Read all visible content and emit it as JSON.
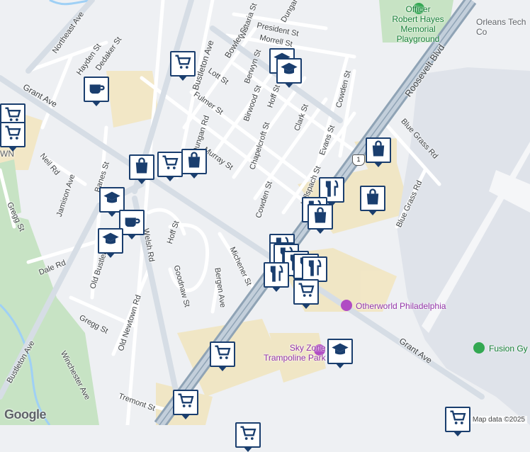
{
  "streets": [
    {
      "name": "Northeast Ave"
    },
    {
      "name": "Hayden St"
    },
    {
      "name": "Dedaker St"
    },
    {
      "name": "Bustleton Ave"
    },
    {
      "name": "Bowler St"
    },
    {
      "name": "Wistaria St"
    },
    {
      "name": "President St"
    },
    {
      "name": "Morrell St"
    },
    {
      "name": "Dungan"
    },
    {
      "name": "Lott St"
    },
    {
      "name": "Berwyn St"
    },
    {
      "name": "Grant Ave"
    },
    {
      "name": "Fulmer St"
    },
    {
      "name": "Birwood St"
    },
    {
      "name": "Hoff St"
    },
    {
      "name": "Cowden St"
    },
    {
      "name": "Chapelcroft St"
    },
    {
      "name": "Clark St"
    },
    {
      "name": "Evans St"
    },
    {
      "name": "Dungan Rd"
    },
    {
      "name": "Murray St"
    },
    {
      "name": "Roosevelt Blvd"
    },
    {
      "name": "Blue Grass Rd"
    },
    {
      "name": "Neil Rd"
    },
    {
      "name": "Banes St"
    },
    {
      "name": "Jamison Ave"
    },
    {
      "name": "Gregg St"
    },
    {
      "name": "Hillspach St"
    },
    {
      "name": "Welsh Rd"
    },
    {
      "name": "Hoff St"
    },
    {
      "name": "Dale Rd"
    },
    {
      "name": "Old Bustleton"
    },
    {
      "name": "Goodnaw St"
    },
    {
      "name": "Michener St"
    },
    {
      "name": "Bergen Ave"
    },
    {
      "name": "Old Newtown Rd"
    },
    {
      "name": "Winchester Ave"
    },
    {
      "name": "Tremont St"
    },
    {
      "name": "Bustleton Ave"
    },
    {
      "name": "Gregg St"
    },
    {
      "name": "Cowden St"
    },
    {
      "name": "Grant Ave"
    },
    {
      "name": "Blue Grass Rd"
    }
  ],
  "places": {
    "playground": "Officer\nRobert Hayes\nMemorial\nPlayground",
    "orleans": "Orleans Tech\nCo",
    "otherworld": "Otherworld Philadelphia",
    "skyzone": "Sky Zone\nTrampoline Park",
    "fusion": "Fusion Gy",
    "town_fragment": "WN"
  },
  "route_shield": "1",
  "markers": [
    {
      "type": "cart-icon"
    },
    {
      "type": "school-icon"
    },
    {
      "type": "school-icon"
    },
    {
      "type": "cafe-icon"
    },
    {
      "type": "cart-icon"
    },
    {
      "type": "cart-icon"
    },
    {
      "type": "bag-icon"
    },
    {
      "type": "cart-icon"
    },
    {
      "type": "bag-icon"
    },
    {
      "type": "bag-icon"
    },
    {
      "type": "school-icon"
    },
    {
      "type": "cafe-icon"
    },
    {
      "type": "school-icon"
    },
    {
      "type": "restaurant-icon"
    },
    {
      "type": "bag-icon"
    },
    {
      "type": "restaurant-icon"
    },
    {
      "type": "bag-icon"
    },
    {
      "type": "restaurant-icon"
    },
    {
      "type": "restaurant-icon"
    },
    {
      "type": "restaurant-icon"
    },
    {
      "type": "restaurant-icon"
    },
    {
      "type": "restaurant-icon"
    },
    {
      "type": "restaurant-icon"
    },
    {
      "type": "restaurant-icon"
    },
    {
      "type": "cart-icon"
    },
    {
      "type": "school-icon"
    },
    {
      "type": "cart-icon"
    },
    {
      "type": "cart-icon"
    },
    {
      "type": "cart-icon"
    },
    {
      "type": "cart-icon"
    }
  ],
  "attribution": "Map data ©2025",
  "logo": "Google",
  "colors": {
    "background": "#eef0f3",
    "park": "#c8e6c9",
    "water": "#aadaff",
    "commercial": "#f2e8c9",
    "highway": "#8fa3b5",
    "marker_border": "#1a3e6e"
  }
}
